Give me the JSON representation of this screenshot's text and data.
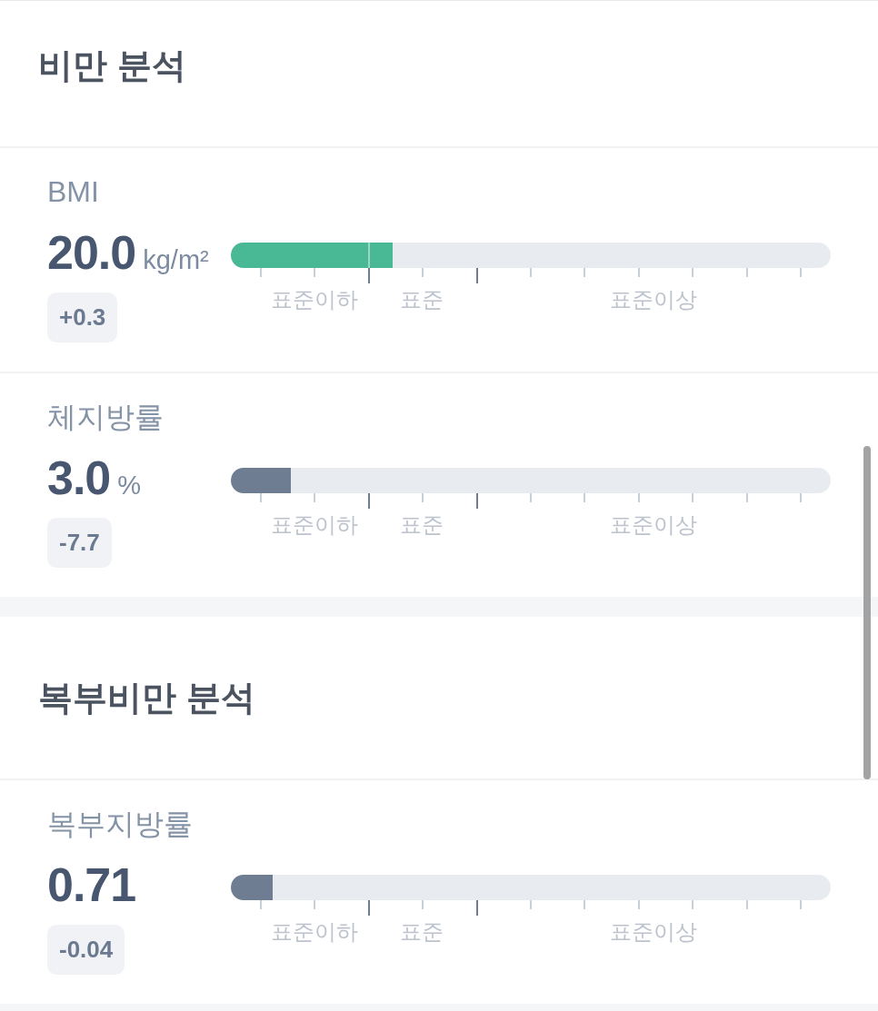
{
  "sections": [
    {
      "title": "비만 분석",
      "metrics": [
        {
          "name": "BMI",
          "value": "20.0",
          "unit": "kg/m²",
          "change": "+0.3",
          "level": 0.27,
          "color": "#48b994",
          "scale_labels": [
            "표준이하",
            "표준",
            "표준이상"
          ]
        },
        {
          "name": "체지방률",
          "value": "3.0",
          "unit": "%",
          "change": "-7.7",
          "level": 0.1,
          "color": "#6f7d92",
          "scale_labels": [
            "표준이하",
            "표준",
            "표준이상"
          ]
        }
      ]
    },
    {
      "title": "복부비만 분석",
      "metrics": [
        {
          "name": "복부지방률",
          "value": "0.71",
          "change": "-0.04",
          "level": 0.07,
          "color": "#6f7d92",
          "scale_labels": [
            "표준이하",
            "표준",
            "표준이상"
          ]
        }
      ]
    }
  ]
}
